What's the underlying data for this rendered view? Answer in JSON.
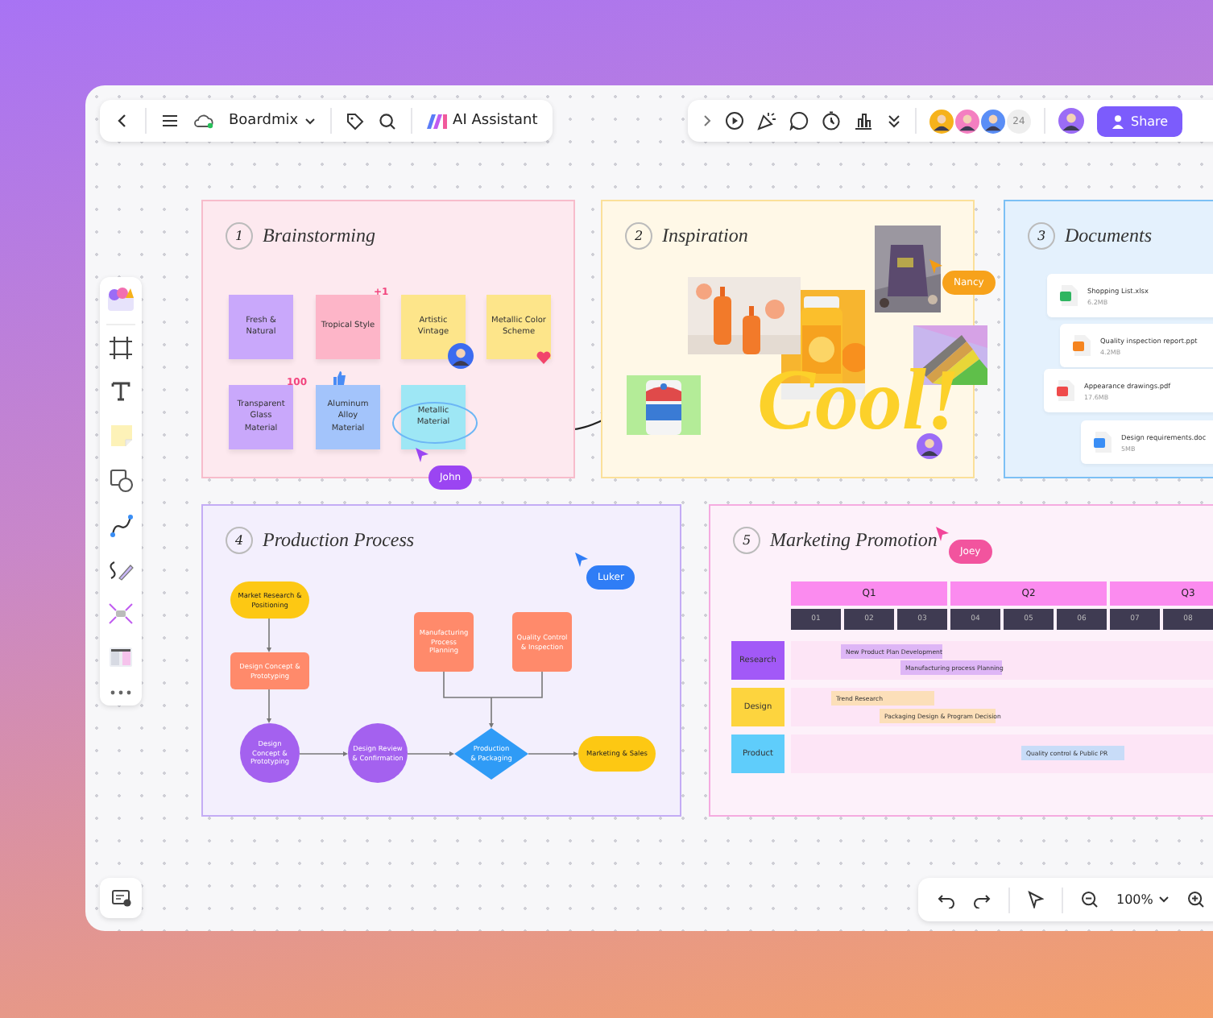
{
  "toolbar": {
    "app_name": "Boardmix",
    "ai_label": "AI Assistant"
  },
  "collaborators": {
    "count": "24"
  },
  "share_button": "Share",
  "frames": [
    {
      "kind": "brainstorm",
      "number": "1",
      "title": "Brainstorming",
      "cursor_label": "John",
      "notes": [
        {
          "text": "Fresh & Natural",
          "color": "#c9a8fb"
        },
        {
          "text": "Tropical Style",
          "color": "#fdb5c8",
          "badge": "+1"
        },
        {
          "text": "Artistic Vintage",
          "color": "#fde58a"
        },
        {
          "text": "Metallic Color Scheme",
          "color": "#fde58a"
        },
        {
          "text": "Transparent Glass Material",
          "color": "#c9a8fb",
          "badge": "100"
        },
        {
          "text": "Aluminum Alloy Material",
          "color": "#a3c4fb"
        },
        {
          "text": "Metallic Material",
          "color": "#9ee7f5"
        }
      ]
    },
    {
      "kind": "inspiration",
      "number": "2",
      "title": "Inspiration",
      "sticker": "Cool!",
      "cursor_label": "Nancy"
    },
    {
      "kind": "documents",
      "number": "3",
      "title": "Documents",
      "files": [
        {
          "name": "Shopping List.xlsx",
          "size": "6.2MB",
          "kind": "sheet"
        },
        {
          "name": "Quality inspection report.ppt",
          "size": "4.2MB",
          "kind": "slides"
        },
        {
          "name": "Appearance drawings.pdf",
          "size": "17.6MB",
          "kind": "pdf"
        },
        {
          "name": "Design requirements.doc",
          "size": "5MB",
          "kind": "doc"
        }
      ]
    },
    {
      "kind": "flowchart",
      "number": "4",
      "title": "Production Process",
      "cursor_label": "Luker",
      "nodes": [
        {
          "text": "Market Research & Positioning",
          "kind": "pill"
        },
        {
          "text": "Design Concept & Prototyping",
          "kind": "rect"
        },
        {
          "text": "Design Concept & Prototyping",
          "kind": "circle"
        },
        {
          "text": "Design Review & Confirmation",
          "kind": "circle"
        },
        {
          "text": "Production & Packaging",
          "kind": "diamond"
        },
        {
          "text": "Marketing & Sales",
          "kind": "pill"
        },
        {
          "text": "Manufacturing Process Planning",
          "kind": "rect"
        },
        {
          "text": "Quality Control & Inspection",
          "kind": "rect"
        }
      ]
    },
    {
      "kind": "timeline",
      "number": "5",
      "title": "Marketing Promotion",
      "cursor_label": "Joey",
      "quarters": [
        "Q1",
        "Q2",
        "Q3"
      ],
      "months": [
        "01",
        "02",
        "03",
        "04",
        "05",
        "06",
        "07",
        "08"
      ],
      "rows": [
        {
          "label": "Research",
          "color": "#a259f7",
          "tasks": [
            "New Product Plan Development",
            "Manufacturing process Planning"
          ]
        },
        {
          "label": "Design",
          "color": "#fdd43e",
          "tasks": [
            "Trend Research",
            "Packaging Design & Program Decision"
          ]
        },
        {
          "label": "Product",
          "color": "#5fcdfb",
          "tasks": [
            "Quality control & Public PR"
          ]
        }
      ]
    }
  ],
  "zoom": {
    "level_text": "100%"
  }
}
